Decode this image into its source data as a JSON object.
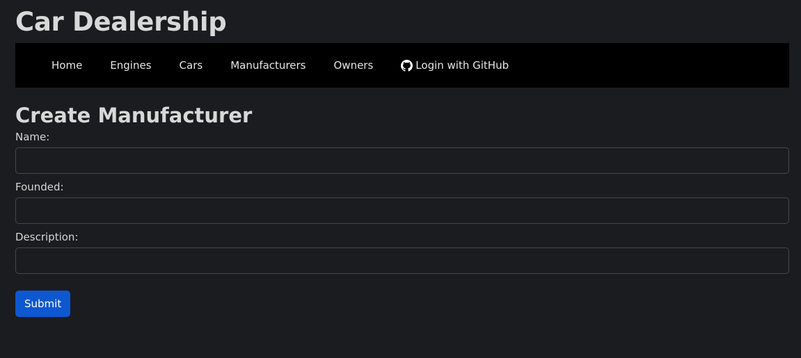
{
  "site": {
    "title": "Car Dealership"
  },
  "nav": {
    "items": [
      {
        "label": "Home"
      },
      {
        "label": "Engines"
      },
      {
        "label": "Cars"
      },
      {
        "label": "Manufacturers"
      },
      {
        "label": "Owners"
      }
    ],
    "login": {
      "label": "Login with GitHub",
      "icon": "github-icon"
    }
  },
  "form": {
    "title": "Create Manufacturer",
    "fields": [
      {
        "label": "Name:",
        "value": ""
      },
      {
        "label": "Founded:",
        "value": ""
      },
      {
        "label": "Description:",
        "value": ""
      }
    ],
    "submit_label": "Submit"
  },
  "colors": {
    "background": "#1b1c1f",
    "navbar": "#000000",
    "primary_button": "#0d57d0"
  }
}
